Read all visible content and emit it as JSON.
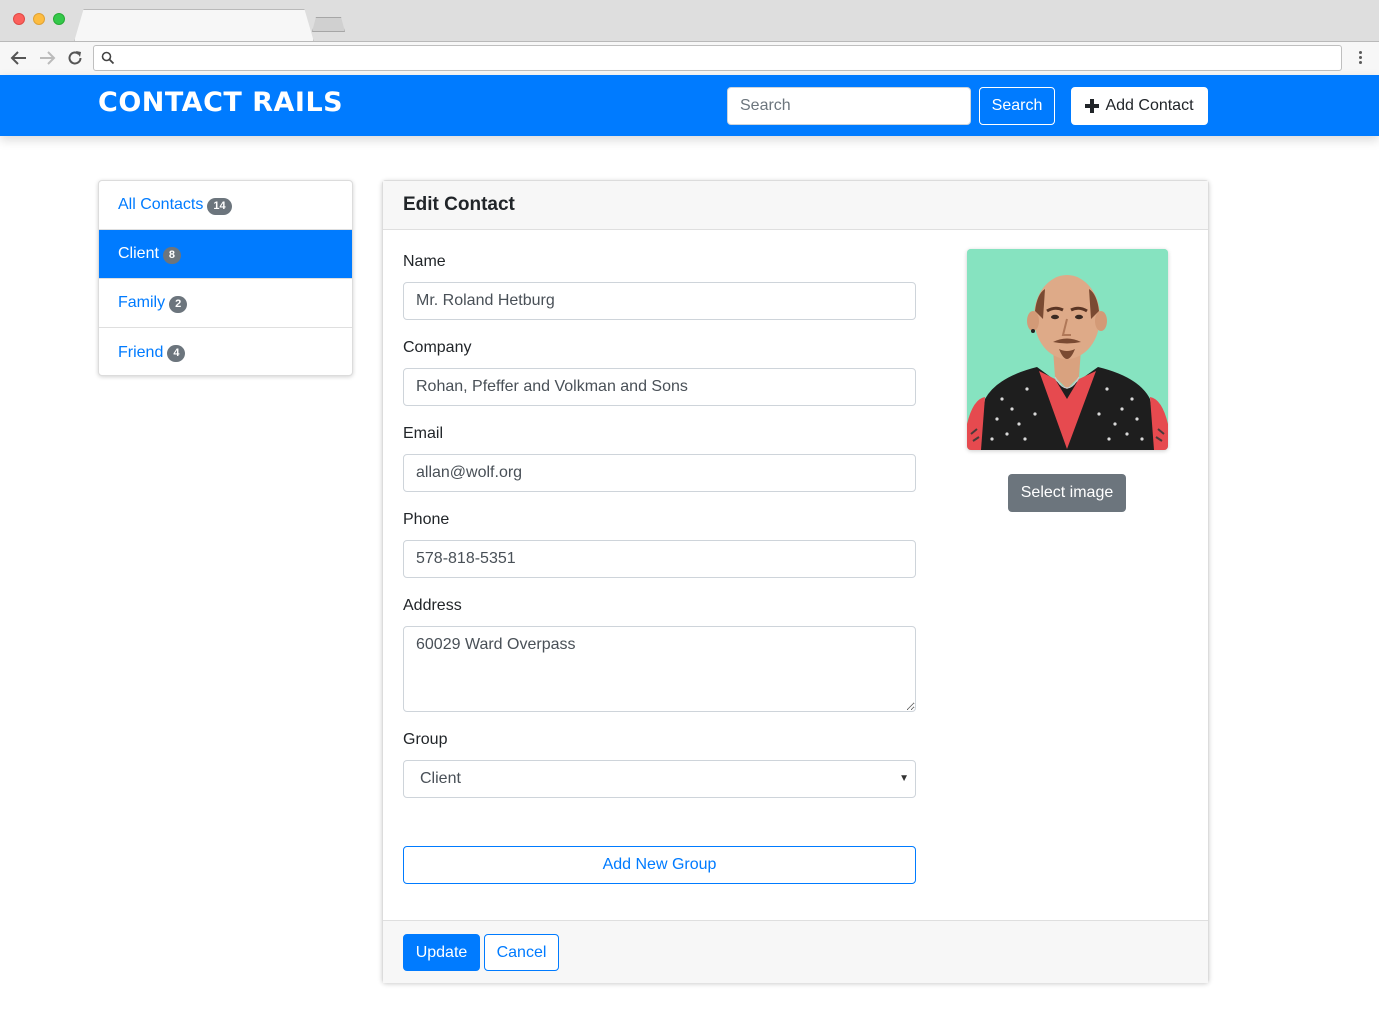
{
  "navbar": {
    "brand": "CONTACT RAILS",
    "search_placeholder": "Search",
    "search_button": "Search",
    "add_contact_button": "Add Contact",
    "color": "#007bff"
  },
  "sidebar": {
    "items": [
      {
        "label": "All Contacts",
        "count": "14",
        "active": false
      },
      {
        "label": "Client",
        "count": "8",
        "active": true
      },
      {
        "label": "Family",
        "count": "2",
        "active": false
      },
      {
        "label": "Friend",
        "count": "4",
        "active": false
      }
    ]
  },
  "form": {
    "title": "Edit Contact",
    "name_label": "Name",
    "name_value": "Mr. Roland Hetburg",
    "company_label": "Company",
    "company_value": "Rohan, Pfeffer and Volkman and Sons",
    "email_label": "Email",
    "email_value": "allan@wolf.org",
    "phone_label": "Phone",
    "phone_value": "578-818-5351",
    "address_label": "Address",
    "address_value": "60029 Ward Overpass",
    "group_label": "Group",
    "group_value": "Client",
    "add_group_button": "Add New Group",
    "select_image_button": "Select image",
    "update_button": "Update",
    "cancel_button": "Cancel"
  },
  "icons": {
    "back": "arrow-left-icon",
    "forward": "arrow-right-icon",
    "reload": "reload-icon",
    "omnibox": "search-icon",
    "menu": "kebab-menu-icon",
    "add": "plus-icon",
    "select": "chevron-down-icon"
  }
}
